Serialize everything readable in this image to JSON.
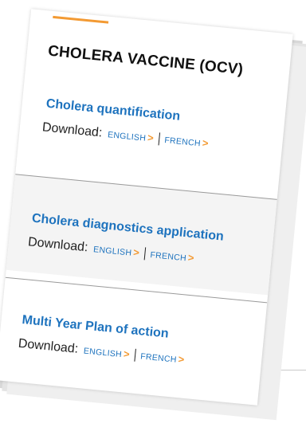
{
  "card": {
    "title": "CHOLERA VACCINE (OCV)",
    "accent_color": "#f39a33",
    "link_color": "#1e73be"
  },
  "items": [
    {
      "title": "Cholera quantification",
      "download_label": "Download:",
      "links": [
        {
          "label": "ENGLISH",
          "icon": "chevron-right-icon",
          "glyph": ">"
        },
        {
          "label": "FRENCH",
          "icon": "chevron-right-icon",
          "glyph": ">"
        }
      ]
    },
    {
      "title": "Cholera diagnostics application",
      "download_label": "Download:",
      "links": [
        {
          "label": "ENGLISH",
          "icon": "chevron-right-icon",
          "glyph": ">"
        },
        {
          "label": "FRENCH",
          "icon": "chevron-right-icon",
          "glyph": ">"
        }
      ]
    },
    {
      "title": "Multi Year Plan of action",
      "download_label": "Download:",
      "links": [
        {
          "label": "ENGLISH",
          "icon": "chevron-right-icon",
          "glyph": ">"
        },
        {
          "label": "FRENCH",
          "icon": "chevron-right-icon",
          "glyph": ">"
        }
      ]
    }
  ]
}
